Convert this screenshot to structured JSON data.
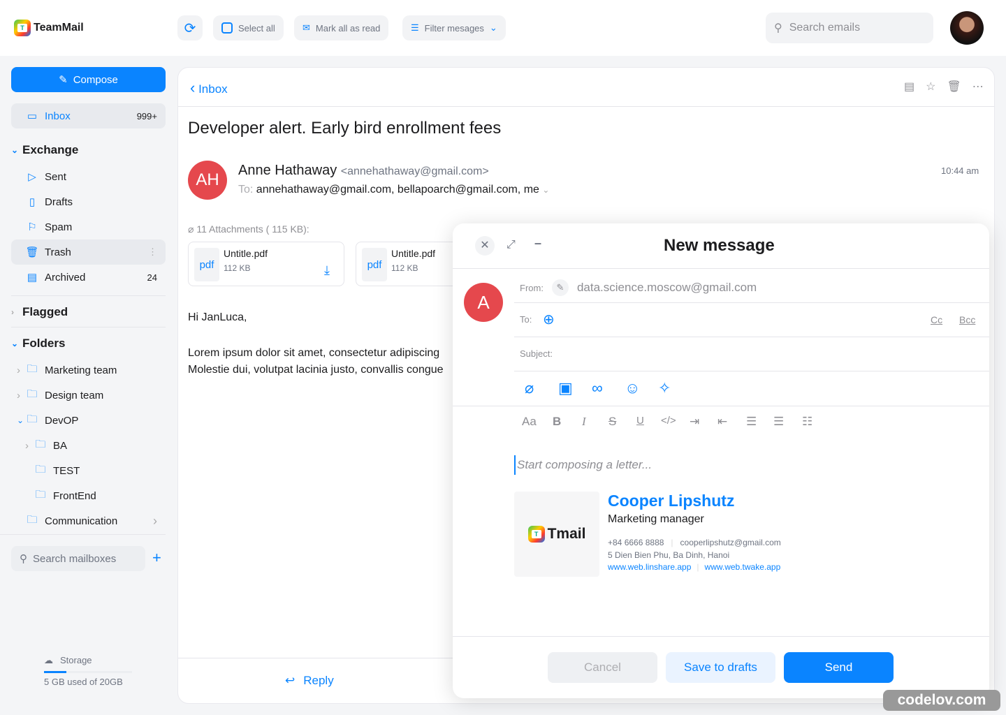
{
  "app": {
    "name": "TeamMail"
  },
  "toolbar": {
    "select_all": "Select all",
    "mark_read": "Mark all as read",
    "filter": "Filter mesages",
    "search_placeholder": "Search emails"
  },
  "sidebar": {
    "compose": "Compose",
    "inbox": {
      "label": "Inbox",
      "count": "999+"
    },
    "exchange": "Exchange",
    "exchange_items": [
      {
        "label": "Sent"
      },
      {
        "label": "Drafts"
      },
      {
        "label": "Spam"
      },
      {
        "label": "Trash"
      },
      {
        "label": "Archived",
        "count": "24"
      }
    ],
    "flagged": "Flagged",
    "folders": "Folders",
    "folder_items": [
      "Marketing team",
      "Design team",
      "DevOP",
      "BA",
      "TEST",
      "FrontEnd",
      "Communication"
    ],
    "search_placeholder": "Search mailboxes",
    "storage": {
      "label": "Storage",
      "text": "5 GB used of 20GB",
      "used_fraction": 0.25
    }
  },
  "email": {
    "back": "Inbox",
    "subject": "Developer alert. Early bird enrollment fees",
    "initials": "AH",
    "sender_name": "Anne Hathaway",
    "sender_email": "<annehathaway@gmail.com>",
    "to_label": "To:",
    "to": "annehathaway@gmail.com, bellapoarch@gmail.com, me",
    "time": "10:44 am",
    "attachments_label": "11 Attachments ( 115 KB):",
    "attachments": [
      {
        "type": "pdf",
        "name": "Untitle.pdf",
        "size": "112 KB"
      },
      {
        "type": "pdf",
        "name": "Untitle.pdf",
        "size": "112 KB"
      }
    ],
    "greeting": "Hi JanLuca,",
    "body1": "Lorem ipsum dolor sit amet, consectetur adipiscing",
    "body2": "Molestie dui, volutpat lacinia justo, convallis congue",
    "reply": "Reply"
  },
  "composer": {
    "title": "New message",
    "avatar": "A",
    "from_label": "From:",
    "from": "data.science.moscow@gmail.com",
    "to_label": "To:",
    "cc": "Cc",
    "bcc": "Bcc",
    "subject_label": "Subject:",
    "font_label": "Aa",
    "placeholder": "Start composing a letter...",
    "signature": {
      "logo": "Tmail",
      "name": "Cooper Lipshutz",
      "role": "Marketing manager",
      "phone": "+84 6666 8888",
      "email": "cooperlipshutz@gmail.com",
      "address": "5 Dien Bien Phu, Ba Dinh, Hanoi",
      "link1": "www.web.linshare.app",
      "link2": "www.web.twake.app"
    },
    "cancel": "Cancel",
    "save": "Save to drafts",
    "send": "Send"
  },
  "watermark": "codelov.com",
  "colors": {
    "accent": "#0a84ff",
    "avatar": "#e5484d"
  }
}
